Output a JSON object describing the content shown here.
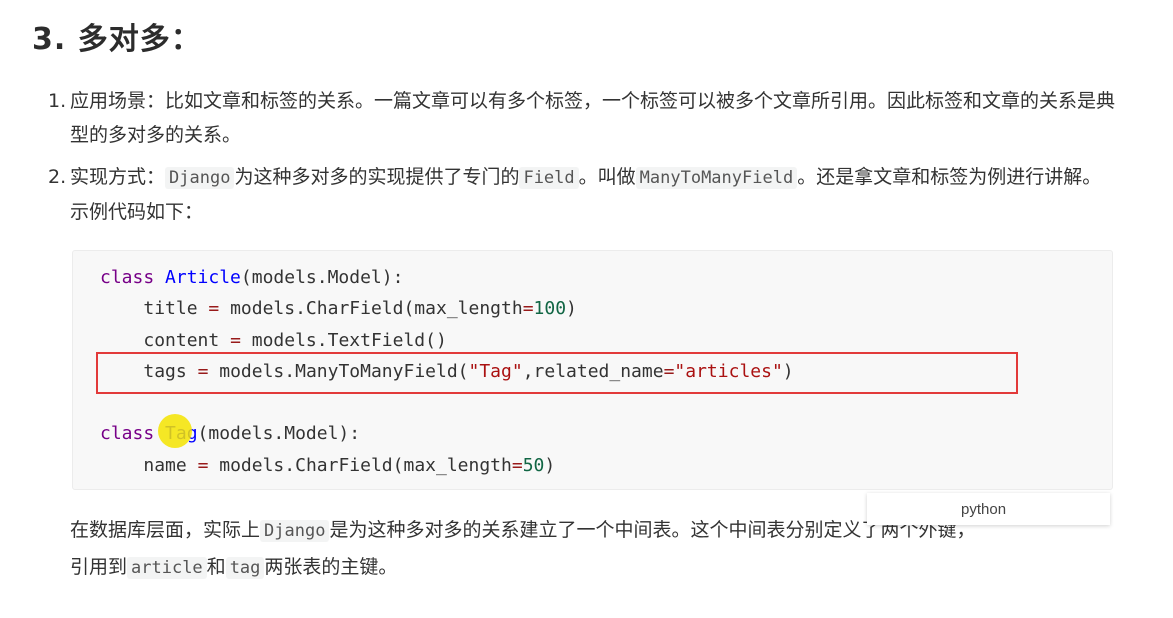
{
  "heading": "3. 多对多：",
  "list": [
    {
      "number": "1.",
      "text": "应用场景：比如文章和标签的关系。一篇文章可以有多个标签，一个标签可以被多个文章所引用。因此标签和文章的关系是典型的多对多的关系。"
    },
    {
      "number": "2.",
      "text_a": "实现方式：",
      "code_a": "Django",
      "text_b": "为这种多对多的实现提供了专门的",
      "code_b": "Field",
      "text_c": "。叫做",
      "code_c": "ManyToManyField",
      "text_d": "。还是拿文章和标签为例进行讲解。示例代码如下："
    }
  ],
  "code": {
    "kw_class": "class",
    "article_name": "Article",
    "article_base": "(models.Model):",
    "title_field": "title",
    "title_rhs": "models.CharField(max_length",
    "title_len": "100",
    "content_field": "content",
    "content_rhs": "models.TextField()",
    "tags_field": "tags",
    "tags_rhs": "models.ManyToManyField(",
    "tags_arg": "\"Tag\"",
    "tags_kw": ",related_name",
    "tags_related": "\"articles\"",
    "tag_name": "Tag",
    "tag_base": "(models.Model):",
    "name_field": "name",
    "name_rhs": "models.CharField(max_length",
    "name_len": "50",
    "op_eq": "=",
    "paren_close": ")"
  },
  "language_label": "python",
  "paragraph": {
    "text_a": "在数据库层面，实际上",
    "code_a": "Django",
    "text_b": "是为这种多对多的关系建立了一个中间表。这个中间表分别定义了两个外键，",
    "text_c": "引用到",
    "code_b": "article",
    "text_d": "和",
    "code_c": "tag",
    "text_e": "两张表的主键。"
  },
  "colors": {
    "highlight_border": "#e23a3a",
    "cursor_marker": "#f5e400",
    "keyword": "#770088",
    "definition": "#0000ff",
    "string": "#aa1111",
    "number": "#116644"
  }
}
